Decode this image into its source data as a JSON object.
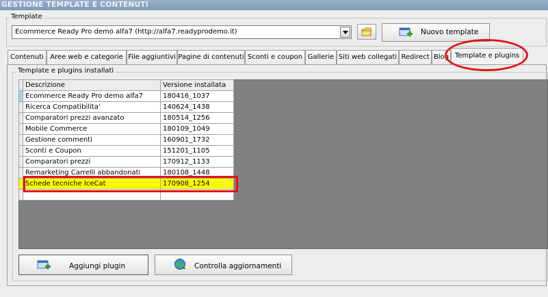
{
  "window": {
    "title": "GESTIONE TEMPLATE E CONTENUTI"
  },
  "template_group": {
    "label": "Template",
    "combo_value": "Ecommerce Ready Pro demo alfa7 (http://alfa7.readyprodemo.it)",
    "new_template_label": "Nuovo template"
  },
  "tabs": [
    {
      "label": "Contenuti"
    },
    {
      "label": "Aree web e categorie"
    },
    {
      "label": "File aggiuntivi"
    },
    {
      "label": "Pagine di contenuti"
    },
    {
      "label": "Sconti e coupon"
    },
    {
      "label": "Gallerie"
    },
    {
      "label": "Siti web collegati"
    },
    {
      "label": "Redirect"
    },
    {
      "label": "Blog"
    },
    {
      "label": "Template e plugins"
    }
  ],
  "active_tab": "Template e plugins",
  "plugins_group": {
    "label": "Template e plugins installati",
    "columns": {
      "description": "Descrizione",
      "version": "Versione installata"
    },
    "rows": [
      {
        "description": "Ecommerce Ready Pro demo alfa7",
        "version": "180416_1037"
      },
      {
        "description": "Ricerca Compatibilita'",
        "version": "140624_1438"
      },
      {
        "description": "Comparatori prezzi avanzato",
        "version": "180514_1256"
      },
      {
        "description": "Mobile Commerce",
        "version": "180109_1049"
      },
      {
        "description": "Gestione commenti",
        "version": "160901_1732"
      },
      {
        "description": "Sconti e Coupon",
        "version": "151201_1105"
      },
      {
        "description": "Comparatori prezzi",
        "version": "170912_1133"
      },
      {
        "description": "Remarketing Carrelli abbandonati",
        "version": "180108_1448"
      },
      {
        "description": "Schede tecniche IceCat",
        "version": "170908_1254"
      },
      {
        "description": "",
        "version": ""
      }
    ],
    "highlighted_row": "Schede tecniche IceCat"
  },
  "buttons": {
    "add_plugin": "Aggiungi plugin",
    "check_updates": "Controlla aggiornamenti"
  },
  "colors": {
    "highlight_row": "#ffff00",
    "annotation_red": "#e21414",
    "grid_background": "#808080"
  }
}
